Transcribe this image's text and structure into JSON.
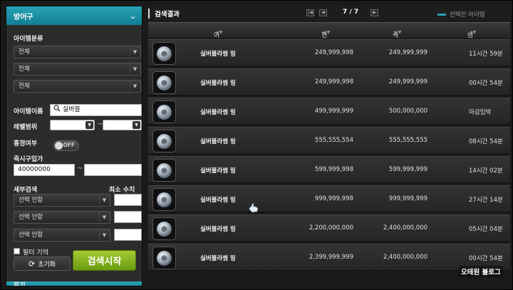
{
  "sidebar": {
    "header": "방어구",
    "category_label": "아이템분류",
    "category_selects": [
      "전체",
      "전체",
      "전체"
    ],
    "item_name_label": "아이템이름",
    "item_name_value": "실버블",
    "level_label": "레벨범위",
    "level_dash": "~",
    "bargain_label": "흥정여부",
    "bargain_toggle": "OFF",
    "instant_label": "즉시구입가",
    "instant_min": "40000000",
    "instant_dash": "~",
    "detail_label": "세부검색",
    "min_value_label": "최소 수치",
    "detail_selects": [
      "선택 안함",
      "선택 안함",
      "선택 안함"
    ],
    "filter_memory_label": "필터 기억",
    "reset_label": "초기화",
    "reset_icon": "refresh-icon",
    "search_button": "검색시작",
    "footer_label": "무기"
  },
  "results": {
    "title": "검색결과",
    "page": "7 / 7",
    "legend": "선택된 아이템",
    "accent": "#2aa2b6",
    "columns": [
      "아이템 이름",
      "현재 입찰가",
      "즉시구입가",
      "남은시간"
    ],
    "rows": [
      {
        "name": "실버블라썸 링",
        "bid": "249,999,998",
        "buy": "249,999,999",
        "time": "11시간 59분"
      },
      {
        "name": "실버블라썸 링",
        "bid": "249,999,998",
        "buy": "249,999,999",
        "time": "00시간 54분"
      },
      {
        "name": "실버블라썸 링",
        "bid": "499,999,999",
        "buy": "500,000,000",
        "time": "마감임박"
      },
      {
        "name": "실버블라썸 링",
        "bid": "555,555,554",
        "buy": "555,555,555",
        "time": "08시간 54분"
      },
      {
        "name": "실버블라썸 링",
        "bid": "599,999,998",
        "buy": "599,999,999",
        "time": "14시간 02분"
      },
      {
        "name": "실버블라썸 링",
        "bid": "999,999,998",
        "buy": "999,999,999",
        "time": "27시간 14분"
      },
      {
        "name": "실버블라썸 링",
        "bid": "2,200,000,000",
        "buy": "2,400,000,000",
        "time": "05시간 04분"
      },
      {
        "name": "실버블라썸 링",
        "bid": "2,399,999,999",
        "buy": "2,400,000,000",
        "time": "00시간 54분"
      }
    ]
  },
  "watermark": "오테원 블로그"
}
